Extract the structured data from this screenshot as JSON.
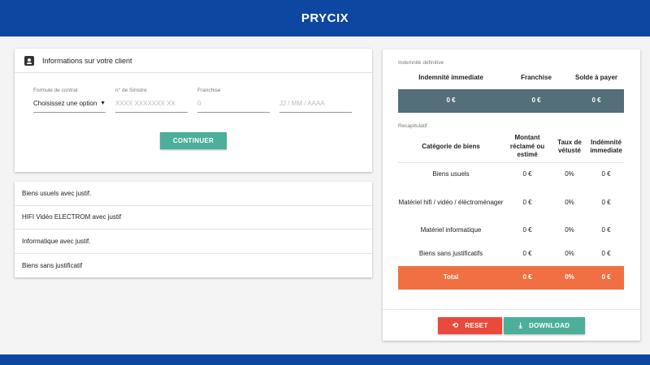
{
  "app": {
    "title": "PRYCIX"
  },
  "client": {
    "header": "Informations sur votre client",
    "fields": [
      {
        "label": "Formule de contrat",
        "value": "Choisissez une option",
        "placeholder": ""
      },
      {
        "label": "n° de Sinistre",
        "value": "",
        "placeholder": "XXXX XXXXXXX XX"
      },
      {
        "label": "Franchise",
        "value": "",
        "placeholder": "0"
      },
      {
        "label": "",
        "value": "",
        "placeholder": "JJ / MM / AAAA"
      }
    ],
    "continue_label": "CONTINUER"
  },
  "categories": [
    "Biens usuels avec justif.",
    "HIFI Vidéo ELECTROM avec justif",
    "Informatique avec justif.",
    "Biens sans justificatif"
  ],
  "summary": {
    "definitive_label": "Indemnité définitive",
    "definitive_headers": [
      "Indemnité immediate",
      "Franchise",
      "Solde à payer"
    ],
    "definitive_values": [
      "0 €",
      "0 €",
      "0 €"
    ],
    "recap_label": "Recapitulatif",
    "recap_headers": [
      "Catégorie de biens",
      "Montant réclamé ou estimé",
      "Taux de vétusté",
      "Indémnité immediate"
    ],
    "recap_rows": [
      {
        "category": "Biens usuels",
        "amount": "0 €",
        "rate": "0%",
        "immediate": "0 €"
      },
      {
        "category": "Matériel hifi / vidéo / éléctroménager",
        "amount": "0 €",
        "rate": "0%",
        "immediate": "0 €"
      },
      {
        "category": "Matériel informatique",
        "amount": "0 €",
        "rate": "0%",
        "immediate": "0 €"
      },
      {
        "category": "Biens sans justificatifs",
        "amount": "0 €",
        "rate": "0%",
        "immediate": "0 €"
      }
    ],
    "total": {
      "label": "Total",
      "amount": "0 €",
      "rate": "0%",
      "immediate": "0 €"
    },
    "reset_label": "RESET",
    "download_label": "DOWNLOAD"
  },
  "colors": {
    "header_blue": "#0d47a1",
    "teal": "#4caf9a",
    "slate": "#546e7a",
    "orange": "#f07043",
    "red": "#e84b3c"
  },
  "icons": {
    "client": "contact-card-icon",
    "dropdown": "caret-down-icon",
    "reset": "history-icon",
    "download": "download-icon"
  }
}
